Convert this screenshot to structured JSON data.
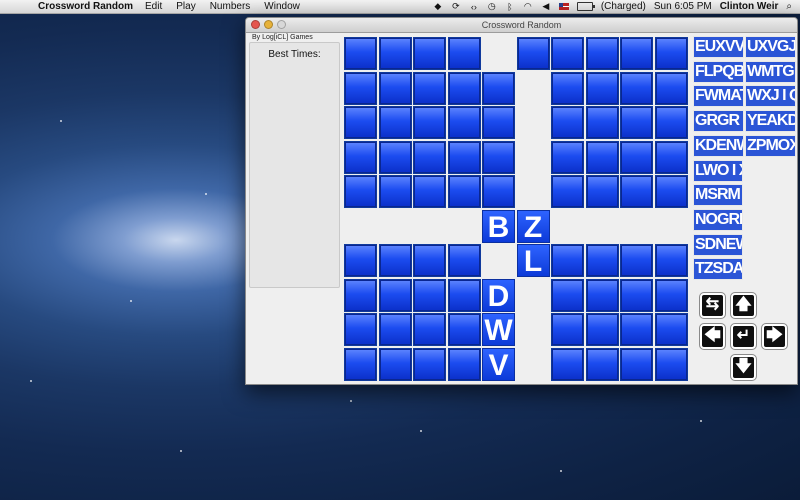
{
  "menubar": {
    "app_name": "Crossword Random",
    "menus": [
      "Edit",
      "Play",
      "Numbers",
      "Window"
    ],
    "battery_status": "(Charged)",
    "clock": "Sun 6:05 PM",
    "user": "Clinton Weir"
  },
  "window": {
    "title": "Crossword Random",
    "byline": "By Log[iCL] Games",
    "best_times_label": "Best Times:"
  },
  "grid": {
    "size": 10,
    "rows": [
      "####.#####",
      "#####.####",
      "#####.####",
      "#####.####",
      "#####.####",
      "....BZ....",
      "####.L####",
      "####D.####",
      "####W.####",
      "####V.####"
    ]
  },
  "words": [
    "EUXVV",
    "UXVGJ",
    "FLPQB",
    "WMTG I",
    "FWMAT",
    "WXJ I Q",
    "GRGR I",
    "YEAKD",
    "KDENW",
    "ZPMOX",
    "LWO I X",
    "MSRM I",
    "NOGRP",
    "SDNEW",
    "TZSDA"
  ],
  "controls": {
    "swap": "⇆",
    "up": "🡅",
    "left": "🡄",
    "enter": "↵",
    "right": "🡆",
    "down": "🡇"
  },
  "colors": {
    "tile_blue": "#1c4cf0",
    "word_blue": "#2b55d6",
    "control_black": "#0f0f0f"
  }
}
